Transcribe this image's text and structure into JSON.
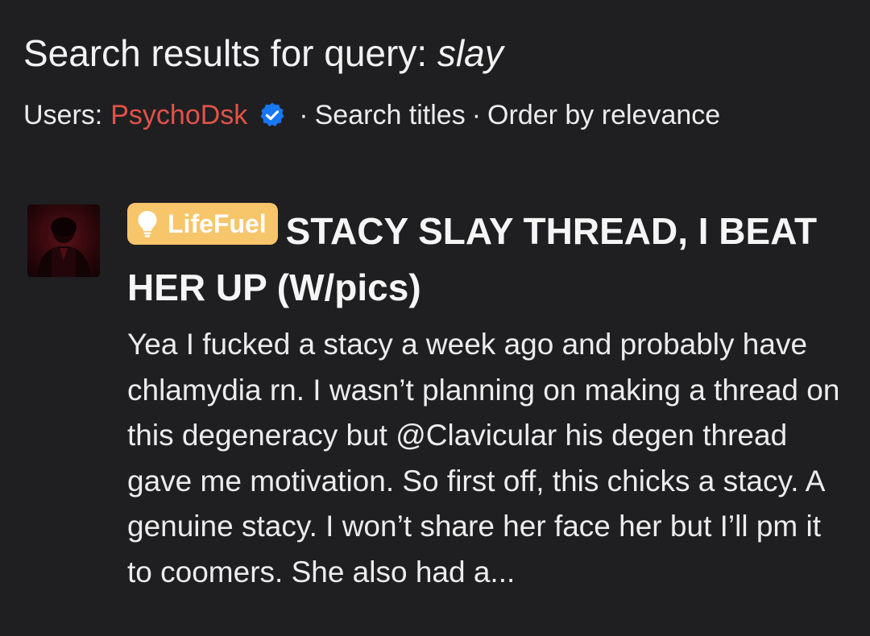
{
  "search": {
    "heading_prefix": "Search results for query:",
    "query": "slay"
  },
  "filters": {
    "users_label": "Users:",
    "username": "PsychoDsk",
    "verified_icon": "verified-check-icon",
    "separator": "·",
    "search_titles": "Search titles",
    "order_by": "Order by relevance"
  },
  "results": [
    {
      "avatar": "user-avatar",
      "prefix": {
        "icon": "lightbulb-icon",
        "label": "LifeFuel",
        "color": "#f7c56a"
      },
      "title_before": "STACY",
      "title_highlight": "SLAY",
      "title_after": "THREAD, I BEAT HER UP (W/pics)",
      "snippet": "Yea I fucked a stacy a week ago and probably have chlamydia rn. I wasn’t planning on making a thread on this degeneracy but @Clavicular his degen thread gave me motivation. So first off, this chicks a stacy. A genuine stacy. I won’t share her face her but I’ll pm it to coomers. She also had a..."
    }
  ],
  "colors": {
    "background": "#1f1f21",
    "username": "#e2524a",
    "verified": "#1877f2",
    "badge": "#f7c56a"
  }
}
